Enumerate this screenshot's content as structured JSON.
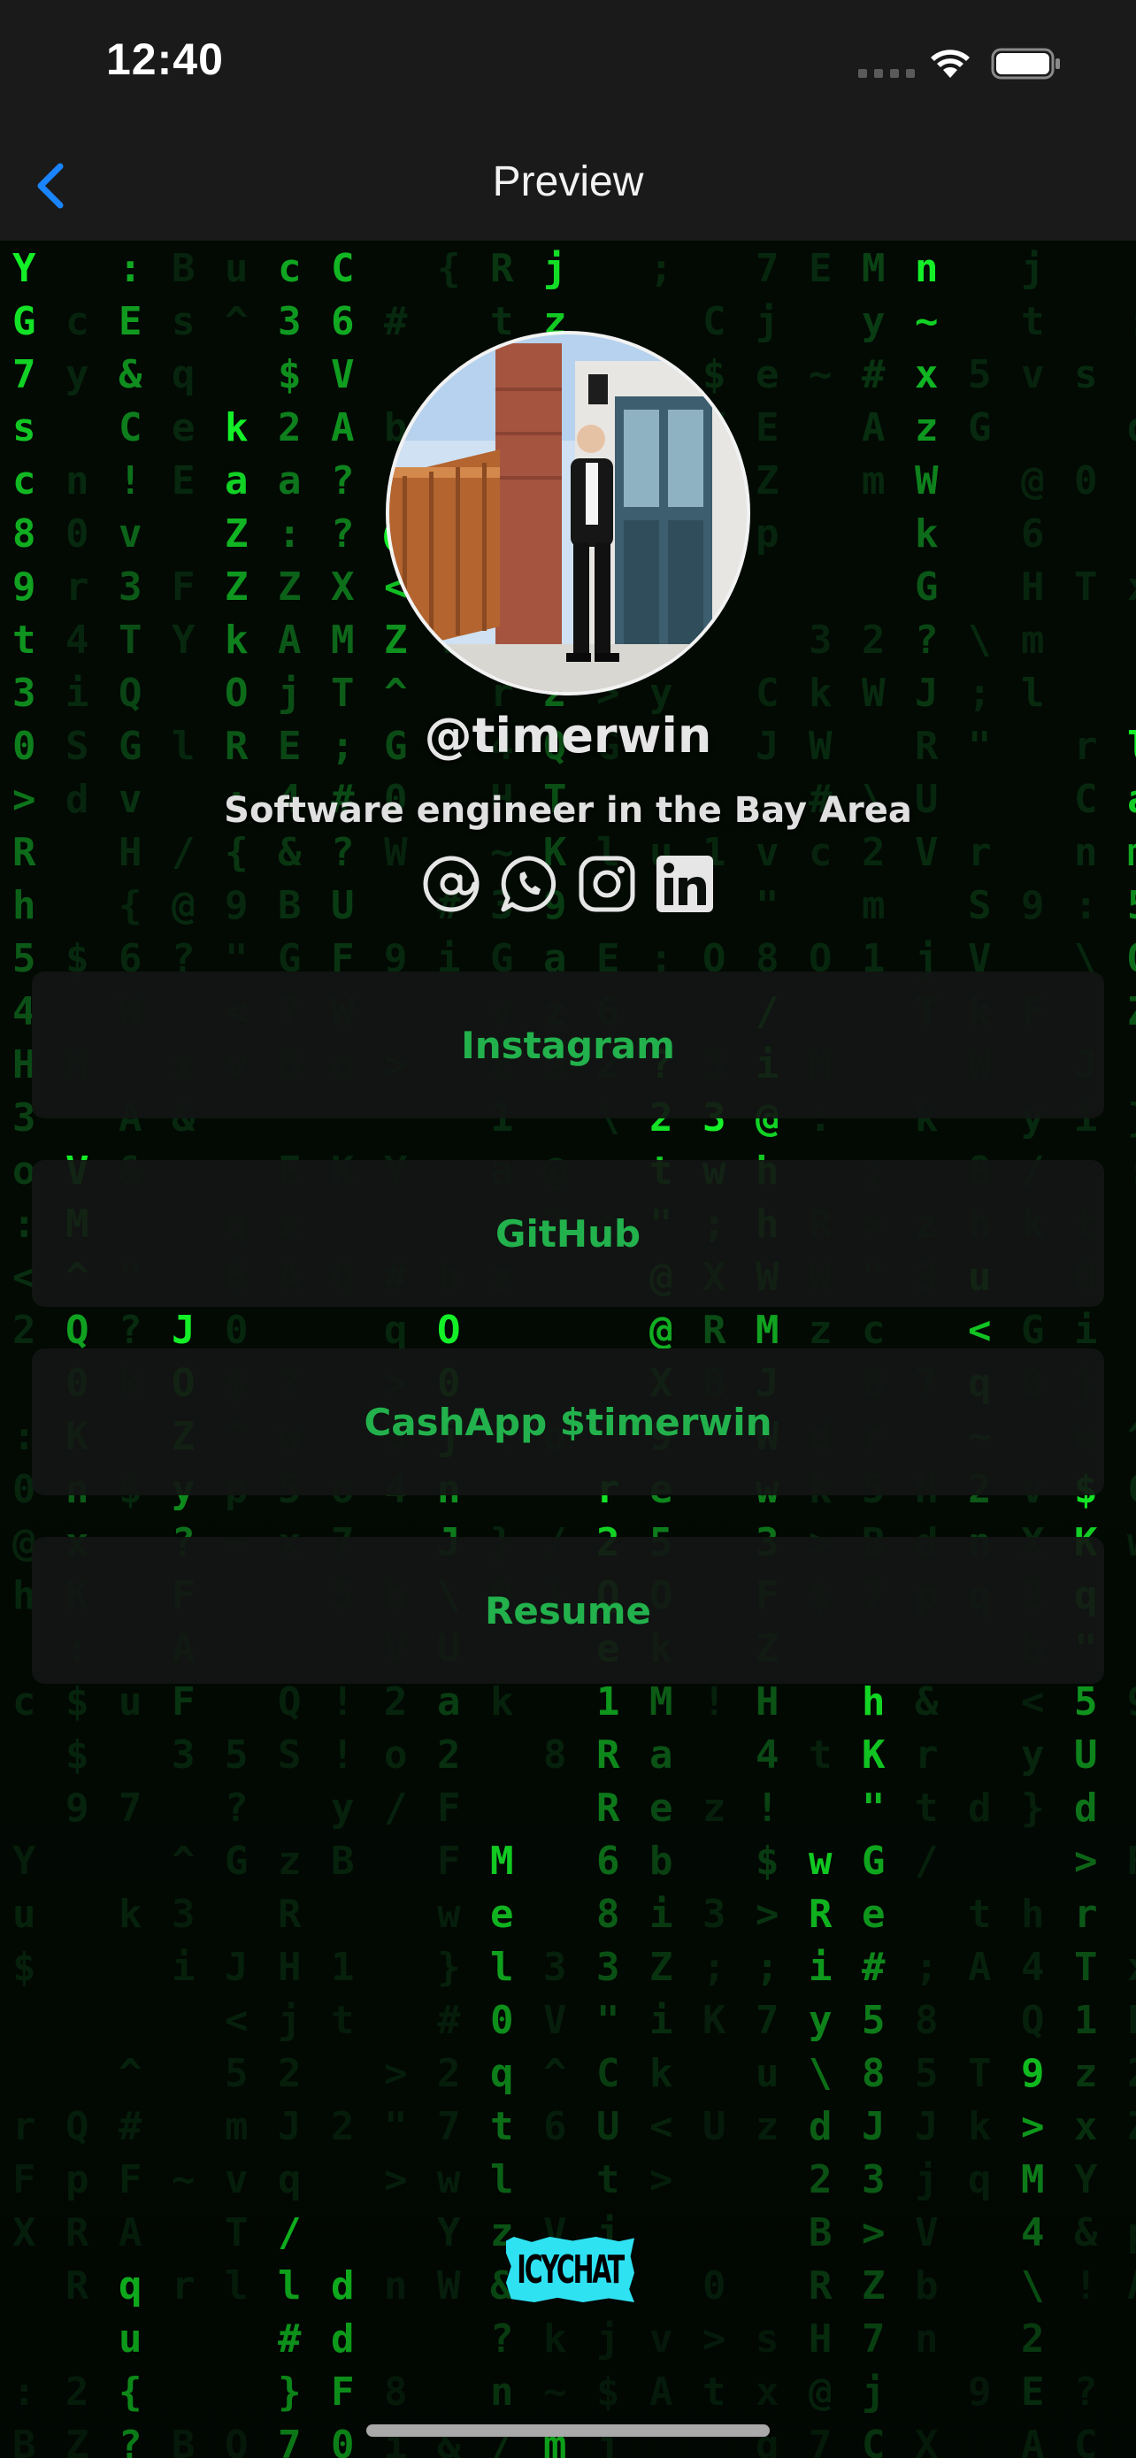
{
  "status_bar": {
    "time": "12:40"
  },
  "nav": {
    "title": "Preview",
    "back_icon": "chevron-left-icon",
    "accent_color": "#1a84ff"
  },
  "profile": {
    "username": "@timerwin",
    "bio": "Software engineer in the Bay Area",
    "social_icons": [
      "email-at-icon",
      "whatsapp-icon",
      "instagram-icon",
      "linkedin-icon"
    ]
  },
  "links": [
    {
      "label": "Instagram"
    },
    {
      "label": "GitHub"
    },
    {
      "label": "CashApp $timerwin"
    },
    {
      "label": "Resume"
    }
  ],
  "theme": {
    "background": "matrix-code",
    "link_text_color": "#22b14c",
    "code_color": "#1fd13a"
  },
  "footer": {
    "brand": "ICYCHAT",
    "brand_color": "#2fe2f2"
  }
}
